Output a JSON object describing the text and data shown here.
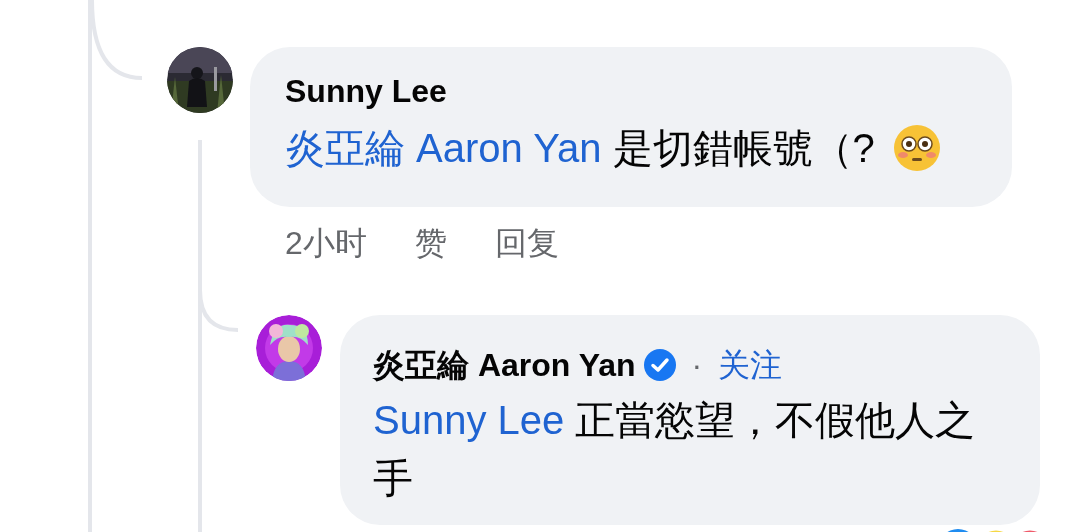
{
  "comment": {
    "author": "Sunny Lee",
    "mention": "炎亞綸 Aaron Yan",
    "text": "是切錯帳號（?",
    "time": "2小时",
    "actions": [
      "赞",
      "回复"
    ]
  },
  "reply": {
    "author": "炎亞綸 Aaron Yan",
    "verified": true,
    "separator": "·",
    "follow": "关注",
    "mention": "Sunny Lee",
    "text": "正當慾望，不假他人之手"
  }
}
